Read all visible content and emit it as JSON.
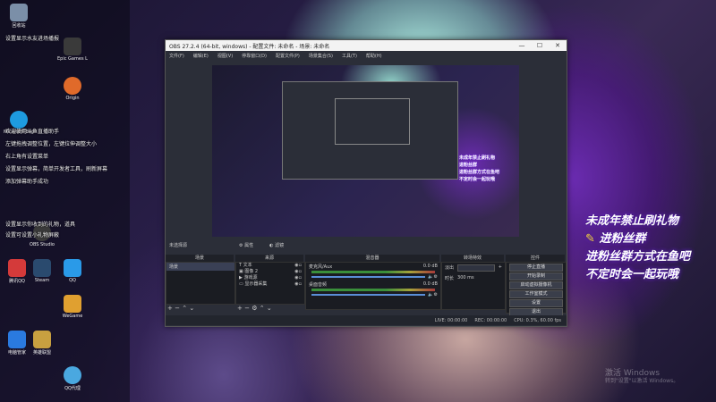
{
  "desktop": {
    "icons": [
      {
        "label": "回收站",
        "color": "#7b8fa8"
      },
      {
        "label": "Epic Games Launcher",
        "color": "#3a3a3a"
      },
      {
        "label": "Origin",
        "color": "#e06a2a"
      },
      {
        "label": "Microsoft Edge",
        "color": "#1e9be0"
      },
      {
        "label": "Steam",
        "color": "#2a4a6e"
      },
      {
        "label": "QQ",
        "color": "#2a9ae8"
      },
      {
        "label": "腾讯QQ",
        "color": "#d43a3a"
      },
      {
        "label": "OBS Studio",
        "color": "#3a3a3a"
      },
      {
        "label": "WeGame",
        "color": "#e0a030"
      },
      {
        "label": "电脑管家",
        "color": "#2a7ae0"
      },
      {
        "label": "英雄联盟",
        "color": "#c8a040"
      },
      {
        "label": "QQ代理",
        "color": "#4aa8e0"
      }
    ],
    "texts": [
      "设置显示水友进场播报",
      "欢迎使用斗鱼直播助手",
      "左键拖拽调整位置，左键拉伸调整大小",
      "右上角有设置菜单",
      "设置显示弹幕，简单开发者工具，刷新屏幕",
      "添加弹幕助手成功",
      "设置显示你收到的礼物，道具",
      "设置可设置小礼物屏蔽"
    ],
    "watermark": "激活 Windows",
    "watermark_sub": "转到\"设置\"以激活 Windows。"
  },
  "overlay": {
    "line1": "未成年禁止刷礼物",
    "line2": "进粉丝群",
    "line3": "进粉丝群方式在鱼吧",
    "line4": "不定时会一起玩哦"
  },
  "obs": {
    "title": "OBS 27.2.4 (64-bit, windows) - 配置文件: 未命名 - 场景: 未命名",
    "menu": [
      "文件(F)",
      "编辑(E)",
      "视图(V)",
      "停靠窗口(D)",
      "配置文件(P)",
      "场景集合(S)",
      "工具(T)",
      "帮助(H)"
    ],
    "preview_label": "未选择源",
    "properties_btn": "属性",
    "filters_btn": "滤镜",
    "docks": {
      "scenes": {
        "title": "场景",
        "items": [
          "场景"
        ]
      },
      "sources": {
        "title": "来源",
        "items": [
          "文本",
          "图像 2",
          "游戏源",
          "显示器采集"
        ]
      },
      "mixer": {
        "title": "混音器",
        "tracks": [
          {
            "name": "麦克风/Aux",
            "level": "0.0 dB"
          },
          {
            "name": "桌面音频",
            "level": "0.0 dB"
          }
        ]
      },
      "transitions": {
        "title": "转场特效",
        "type": "淡出",
        "duration_label": "时长",
        "duration": "300 ms"
      },
      "controls": {
        "title": "控件",
        "buttons": [
          "停止直播",
          "开始录制",
          "启动虚拟摄像机",
          "工作室模式",
          "设置",
          "退出"
        ]
      }
    },
    "statusbar": {
      "live": "LIVE: 00:00:00",
      "rec": "REC: 00:00:00",
      "cpu": "CPU: 0.3%, 60.00 fps"
    }
  }
}
